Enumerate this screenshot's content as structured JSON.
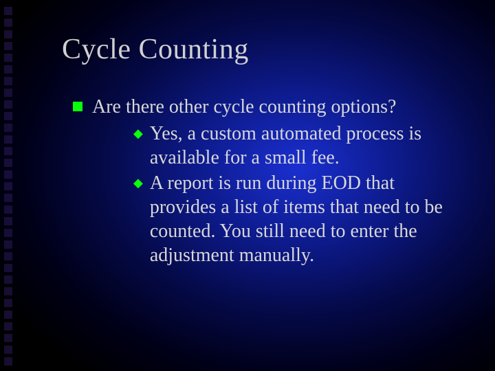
{
  "title": "Cycle Counting",
  "bullet1": "Are there other cycle counting options?",
  "sub1": "Yes, a custom automated process is available for a small fee.",
  "sub2": "A report is run during EOD that provides a list of items that need to be counted. You still need to enter the adjustment manually."
}
